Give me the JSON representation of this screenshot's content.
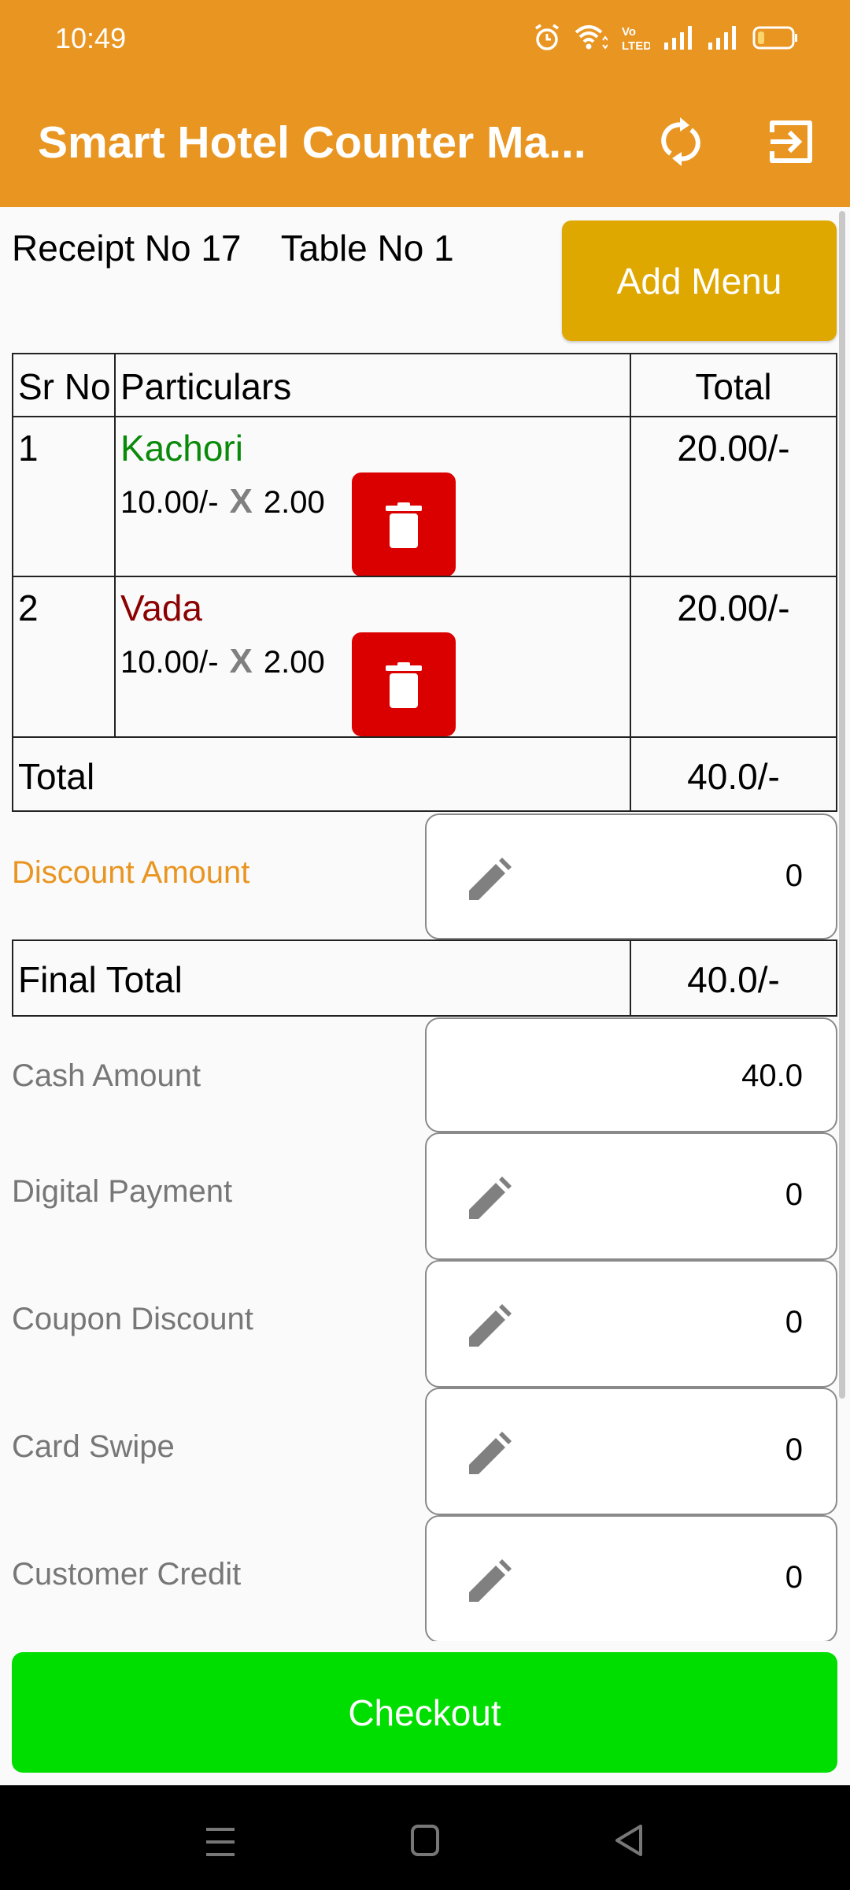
{
  "status_bar": {
    "time": "10:49",
    "icons": [
      "alarm-icon",
      "wifi-icon",
      "volte-icon",
      "signal-icon",
      "signal-icon",
      "battery-icon"
    ],
    "battery_level": 0.15
  },
  "app_bar": {
    "title": "Smart Hotel Counter Ma...",
    "actions": [
      "refresh-icon",
      "logout-icon"
    ]
  },
  "receipt": {
    "info": "Receipt No 17    Table No 1",
    "receipt_no": "17",
    "table_no": "1",
    "add_menu_label": "Add Menu"
  },
  "table": {
    "headers": [
      "Sr No",
      "Particulars",
      "Total"
    ],
    "rows": [
      {
        "sr": "1",
        "name": "Kachori",
        "name_color": "#0a8a0a",
        "price": "10.00/-",
        "times": "X",
        "qty": "2.00",
        "total": "20.00/-"
      },
      {
        "sr": "2",
        "name": "Vada",
        "name_color": "#8b0000",
        "price": "10.00/-",
        "times": "X",
        "qty": "2.00",
        "total": "20.00/-"
      }
    ],
    "total_label": "Total",
    "total_value": "40.0/-"
  },
  "discount": {
    "label": "Discount Amount",
    "value": "0"
  },
  "final_total": {
    "label": "Final Total",
    "value": "40.0/-"
  },
  "payments": [
    {
      "label": "Cash Amount",
      "value": "40.0",
      "editable_icon": false
    },
    {
      "label": "Digital Payment",
      "value": "0",
      "editable_icon": true
    },
    {
      "label": "Coupon Discount",
      "value": "0",
      "editable_icon": true
    },
    {
      "label": "Card Swipe",
      "value": "0",
      "editable_icon": true
    },
    {
      "label": "Customer Credit",
      "value": "0",
      "editable_icon": true
    }
  ],
  "checkout_label": "Checkout",
  "nav_bar": {
    "buttons": [
      "menu-icon",
      "home-icon",
      "back-icon"
    ]
  },
  "colors": {
    "app_bar": "#e99521",
    "add_menu": "#dea800",
    "delete": "#db0000",
    "checkout": "#00de00",
    "discount_label": "#e99521"
  }
}
